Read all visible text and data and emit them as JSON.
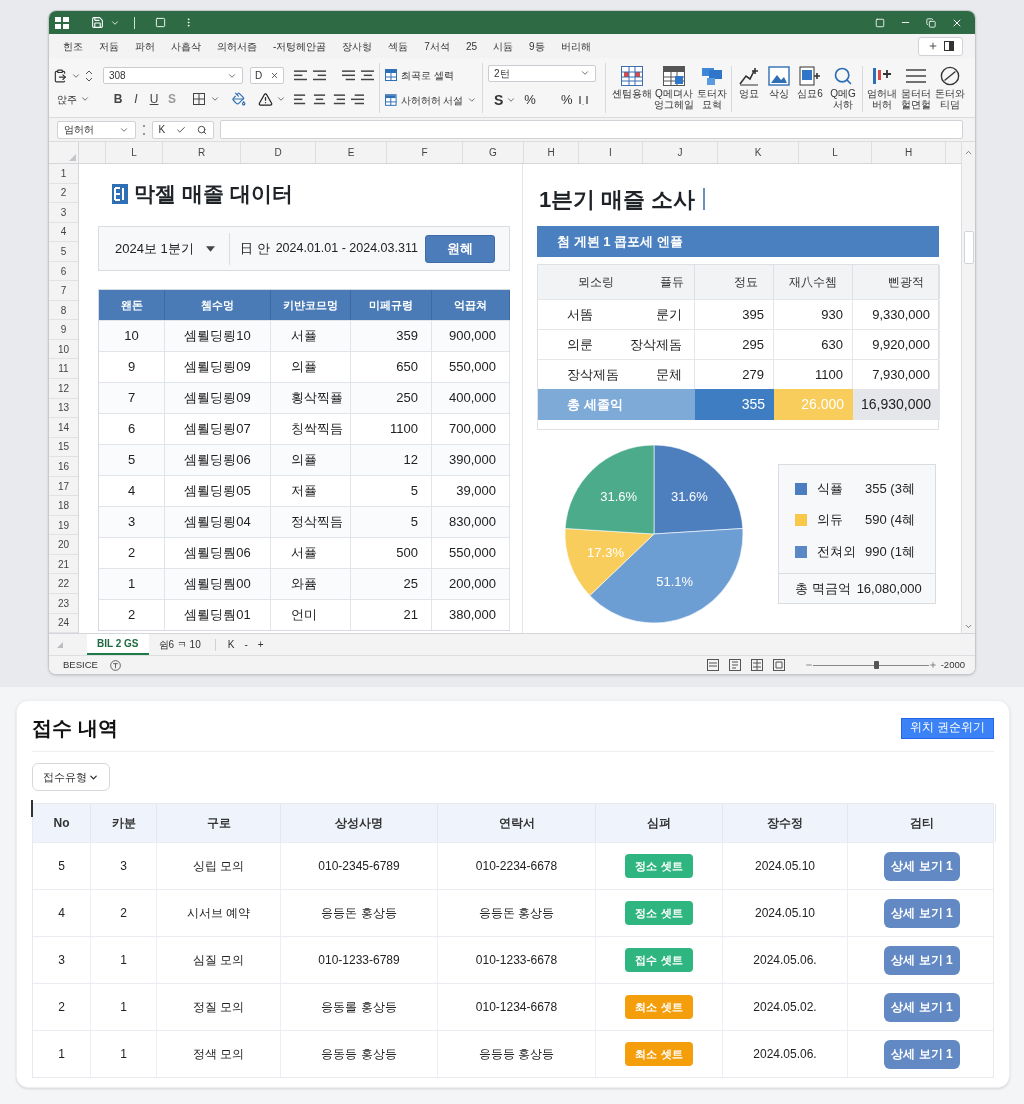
{
  "menu_tabs": [
    "힌조",
    "저듐",
    "파허",
    "사흡삭",
    "의허서즘",
    "-저텅헤안곰",
    "장사헝",
    "섹듐",
    "7서석",
    "25",
    "시듐",
    "9등",
    "버리해"
  ],
  "ribbon": {
    "paste_label": "앉주",
    "font_name": "308",
    "font_size": "D",
    "text_styles": [
      "B",
      "I",
      "U",
      "S"
    ],
    "cell_styles": [
      "최곡로 셀력",
      "사허허허 서설"
    ],
    "number_format": "2턴",
    "currency": "S",
    "percent": [
      "%",
      "%"
    ],
    "commands": [
      {
        "kind": "grid",
        "label": "셴텀용해"
      },
      {
        "kind": "table",
        "label": "Q메뎌사 엉그헤일"
      },
      {
        "kind": "blocks",
        "label": "토터자 묘혁"
      },
      {
        "kind": "lineplus",
        "label": "엉묘"
      },
      {
        "kind": "picture",
        "label": "삭싱"
      },
      {
        "kind": "pictureplus",
        "label": "심묘6"
      },
      {
        "kind": "search",
        "label": "Q메G 서하"
      },
      {
        "kind": "barsplus",
        "label": "엄허내 버허"
      },
      {
        "kind": "lines",
        "label": "뭄터터 헐뎐헐"
      },
      {
        "kind": "circle",
        "label": "돈터와 티덤"
      }
    ]
  },
  "formula_bar": {
    "name_box": "엄허허",
    "cancel": "K"
  },
  "columns": [
    "L",
    "R",
    "D",
    "E",
    "F",
    "G",
    "H",
    "I",
    "J",
    "K",
    "L",
    "H"
  ],
  "row_numbers": [
    "1",
    "2",
    "3",
    "4",
    "5",
    "6",
    "7",
    "8",
    "9",
    "10",
    "11",
    "12",
    "13",
    "14",
    "15",
    "16",
    "17",
    "18",
    "19",
    "20",
    "21",
    "22",
    "23",
    "24"
  ],
  "sales_panel": {
    "title": "막젤 매졸 대이터",
    "period": "2024보 1분기",
    "date_label": "日 안",
    "date_range": "2024.01.01 - 2024.03.311",
    "button": "원혜",
    "table": {
      "columns": [
        "왠돈",
        "쳄수멍",
        "키뱐코므멍",
        "미페규령",
        "억끕쳐"
      ],
      "rows": [
        [
          "10",
          "셈뢸딩룅10",
          "서퓰",
          "359",
          "900,000"
        ],
        [
          "9",
          "셈뢸딩룅09",
          "의퓰",
          "650",
          "550,000"
        ],
        [
          "7",
          "셈뢸딩룅09",
          "횡삭찍퓰",
          "250",
          "400,000"
        ],
        [
          "6",
          "셈뢸딩룅07",
          "칭싹찍듬",
          "1100",
          "700,000"
        ],
        [
          "5",
          "셈뢸딩룅06",
          "의퓰",
          "12",
          "390,000"
        ],
        [
          "4",
          "셈뢸딩룅05",
          "저퓰",
          "5",
          "39,000"
        ],
        [
          "3",
          "셈뢸딩룅04",
          "정삭찍듬",
          "5",
          "830,000"
        ],
        [
          "2",
          "셈뢸딩뤔06",
          "서퓰",
          "500",
          "550,000"
        ],
        [
          "1",
          "셈뢸딩뤔00",
          "와퓸",
          "25",
          "200,000"
        ],
        [
          "2",
          "셈뢸딩뤔01",
          "언미",
          "21",
          "380,000"
        ]
      ]
    }
  },
  "summary_panel": {
    "title": "1븐기 매즐 소사",
    "banner": "첨 게뵌 1 콥포세 엔퓰",
    "table": {
      "columns": [
        {
          "left": "뫼소링",
          "right": "퓰듀"
        },
        "정됴",
        "재八수쳄",
        "삔광적"
      ],
      "rows": [
        [
          {
            "left": "서똠",
            "right": "룬기"
          },
          "395",
          "930",
          "9,330,000"
        ],
        [
          {
            "left": "의룬",
            "right": "장삭제돔"
          },
          "295",
          "630",
          "9,920,000"
        ],
        [
          {
            "left": "장삭제돔",
            "right": "문체"
          },
          "279",
          "1100",
          "7,930,000"
        ]
      ],
      "total": {
        "label": "총 세졸익",
        "cells": [
          {
            "text": "355",
            "color": "#3e7dc1"
          },
          {
            "text": "26.000",
            "color": "#f8cd5b"
          },
          {
            "text": "16,930,000",
            "color": "#e4e6e9"
          }
        ]
      }
    },
    "chart_data": {
      "type": "pie",
      "values": [
        31.6,
        51.1,
        17.3,
        31.6
      ],
      "value_labels": [
        "31.6%",
        "51.1%",
        "17.3%",
        "31.6%"
      ]
    },
    "legend": {
      "items": [
        {
          "name": "식퓰",
          "value": "355 (3혜",
          "color": "#4a7ec0"
        },
        {
          "name": "의듀",
          "value": "590 (4혜",
          "color": "#f9c84a"
        },
        {
          "name": "전쳐외",
          "value": "990 (1혜",
          "color": "#5a88c4"
        }
      ],
      "total_label": "총 멱금억",
      "total_value": "16,080,000"
    }
  },
  "sheet_tabs": [
    {
      "label": "BIL 2 GS",
      "selected": true
    },
    {
      "label": "쉼6 ㅋ 10",
      "selected": false
    }
  ],
  "sheet_nav": [
    "K",
    "-",
    "+"
  ],
  "status_bar": {
    "text": "BESICE",
    "zoom_slider": {
      "level": 0.53
    },
    "zoom": "-2000"
  },
  "reception": {
    "title": "접수 내역",
    "action_button": "위치 권순위기",
    "type_select": "접수유형",
    "columns": [
      "No",
      "카분",
      "구로",
      "상성사명",
      "연락서",
      "심펴",
      "장수정",
      "검티"
    ],
    "rows": [
      {
        "cells": [
          "5",
          "3",
          "싱립 모의",
          "010-2345-6789",
          "010-2234-6678"
        ],
        "status": {
          "label": "정소 셋트",
          "color": "#2fb57f"
        },
        "date": "2024.05.10",
        "action": "상세 보기 1"
      },
      {
        "cells": [
          "4",
          "2",
          "시서브 예약",
          "응등돈 홍상등",
          "응등돈 홍상등"
        ],
        "status": {
          "label": "정소 셋트",
          "color": "#2fb57f"
        },
        "date": "2024.05.10",
        "action": "상세 보기 1"
      },
      {
        "cells": [
          "3",
          "1",
          "심질 모의",
          "010-1233-6789",
          "010-1233-6678"
        ],
        "status": {
          "label": "접수 셋트",
          "color": "#2fb57f"
        },
        "date": "2024.05.06.",
        "action": "상세 보기 1"
      },
      {
        "cells": [
          "2",
          "1",
          "정질 모의",
          "응동롤 홍상등",
          "010-1234-6678"
        ],
        "status": {
          "label": "최소 셋트",
          "color": "#f59e0b"
        },
        "date": "2024.05.02.",
        "action": "상세 보기 1"
      },
      {
        "cells": [
          "1",
          "1",
          "정색 모의",
          "응동등 홍상등",
          "응등등 홍상등"
        ],
        "status": {
          "label": "최소 셋트",
          "color": "#f59e0b"
        },
        "date": "2024.05.06.",
        "action": "상세 보기 1"
      }
    ]
  }
}
